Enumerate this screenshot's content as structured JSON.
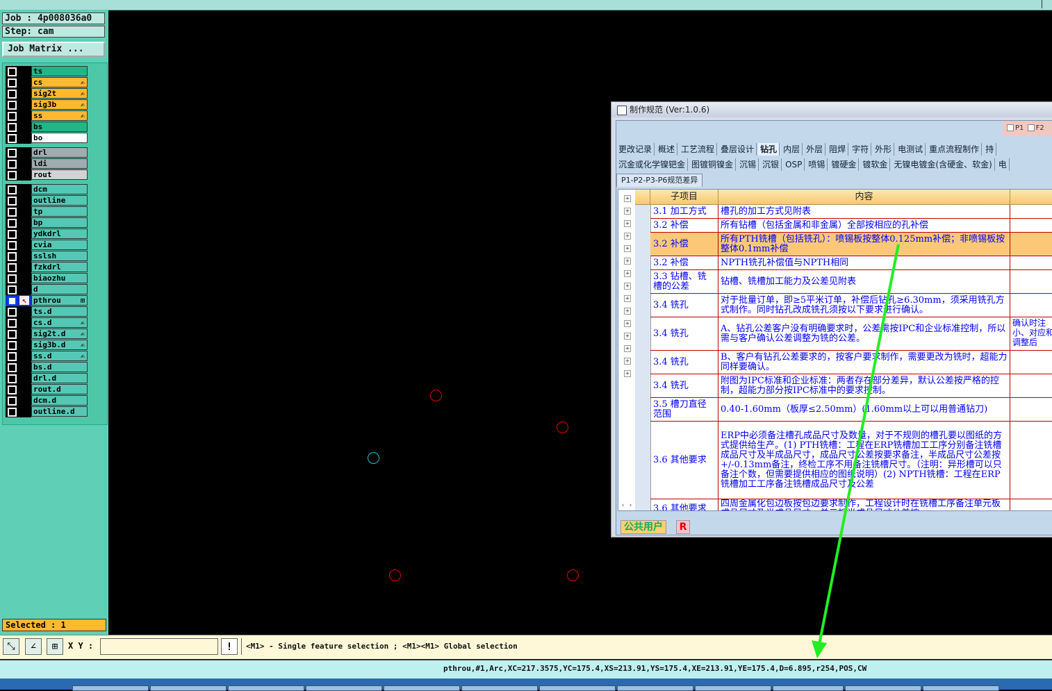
{
  "job": {
    "job_label": "Job : 4p008036a0",
    "step_label": "Step: cam",
    "matrix_button": "Job Matrix ..."
  },
  "layers": [
    {
      "name": "ts",
      "color": "green",
      "mark": ""
    },
    {
      "name": "cs",
      "color": "orange",
      "mark": "✍"
    },
    {
      "name": "sig2t",
      "color": "orange",
      "mark": "✍"
    },
    {
      "name": "sig3b",
      "color": "orange",
      "mark": "✍"
    },
    {
      "name": "ss",
      "color": "orange",
      "mark": "✍"
    },
    {
      "name": "bs",
      "color": "green",
      "mark": ""
    },
    {
      "name": "bo",
      "color": "white",
      "mark": ""
    },
    {
      "name": "drl",
      "color": "gray",
      "mark": ""
    },
    {
      "name": "ldi",
      "color": "gray",
      "mark": ""
    },
    {
      "name": "rout",
      "color": "lgray",
      "mark": ""
    },
    {
      "name": "dcm",
      "color": "teal",
      "mark": ""
    },
    {
      "name": "outline",
      "color": "teal",
      "mark": ""
    },
    {
      "name": "tp",
      "color": "teal",
      "mark": ""
    },
    {
      "name": "bp",
      "color": "teal",
      "mark": ""
    },
    {
      "name": "ydkdrl",
      "color": "teal",
      "mark": ""
    },
    {
      "name": "cvia",
      "color": "teal",
      "mark": ""
    },
    {
      "name": "sslsh",
      "color": "teal",
      "mark": ""
    },
    {
      "name": "fzkdrl",
      "color": "teal",
      "mark": ""
    },
    {
      "name": "biaozhu",
      "color": "teal",
      "mark": ""
    },
    {
      "name": "d",
      "color": "teal",
      "mark": ""
    },
    {
      "name": "pthrou",
      "color": "teal",
      "mark": "⊞",
      "active": true
    },
    {
      "name": "ts.d",
      "color": "teal",
      "mark": ""
    },
    {
      "name": "cs.d",
      "color": "teal",
      "mark": "✍"
    },
    {
      "name": "sig2t.d",
      "color": "teal",
      "mark": "✍"
    },
    {
      "name": "sig3b.d",
      "color": "teal",
      "mark": "✍"
    },
    {
      "name": "ss.d",
      "color": "teal",
      "mark": "✍"
    },
    {
      "name": "bs.d",
      "color": "teal",
      "mark": ""
    },
    {
      "name": "drl.d",
      "color": "teal",
      "mark": ""
    },
    {
      "name": "rout.d",
      "color": "teal",
      "mark": ""
    },
    {
      "name": "dcm.d",
      "color": "teal",
      "mark": ""
    },
    {
      "name": "outline.d",
      "color": "teal",
      "mark": ""
    }
  ],
  "selected_label": "Selected : 1",
  "dialog": {
    "title": "制作规范 (Ver:1.0.6)",
    "p1": "P1",
    "p2": "F2",
    "tabs_row1": [
      "更改记录",
      "概述",
      "工艺流程",
      "叠层设计",
      "钻孔",
      "内层",
      "外层",
      "阻焊",
      "字符",
      "外形",
      "电测试",
      "重点流程制作",
      "持"
    ],
    "active_tab": "钻孔",
    "tabs_row2": [
      "沉金或化学镍钯金",
      "图镀铜镍金",
      "沉锡",
      "沉银",
      "OSP",
      "喷锡",
      "镀硬金",
      "镀软金",
      "无镍电镀金(含硬金、软金)",
      "电"
    ],
    "tab_row3": "P1-P2-P3-P6规范差异",
    "col_sub": "子项目",
    "col_content": "内容",
    "rows": [
      {
        "sub": "3.1 加工方式",
        "content": "槽孔的加工方式见附表",
        "extra": ""
      },
      {
        "sub": "3.2 补偿",
        "content": "所有钻槽（包括金属和非金属）全部按相应的孔补偿",
        "extra": ""
      },
      {
        "sub": "3.2 补偿",
        "content": "所有PTH铣槽（包括铣孔）：喷锡板按整体0.125mm补偿；非喷锡板按整体0.1mm补偿",
        "extra": ""
      },
      {
        "sub": "3.2 补偿",
        "content": "NPTH铣孔补偿值与NPTH相同",
        "extra": ""
      },
      {
        "sub": "3.3 钻槽、铣槽的公差",
        "content": "钻槽、铣槽加工能力及公差见附表",
        "extra": ""
      },
      {
        "sub": "3.4 铣孔",
        "content": "对于批量订单，即≥5平米订单，补偿后钻孔≥6.30mm，须采用铣孔方式制作。同时钻孔改成铣孔须按以下要求进行确认。",
        "extra": ""
      },
      {
        "sub": "3.4 铣孔",
        "content": "A、钻孔公差客户没有明确要求时，公差需按IPC和企业标准控制，所以需与客户确认公差调整为铣的公差。",
        "extra": "确认时注小、对应和调整后"
      },
      {
        "sub": "3.4 铣孔",
        "content": "B、客户有钻孔公差要求的，按客户要求制作，需要更改为铣时，超能力同样要确认。",
        "extra": ""
      },
      {
        "sub": "3.4 铣孔",
        "content": "附图为IPC标准和企业标准：两者存在部分差异，默认公差按严格的控制，超能力部分按IPC标准中的要求控制。",
        "extra": ""
      },
      {
        "sub": "3.5 槽刀直径范围",
        "content": "0.40-1.60mm（板厚≤2.50mm）(1.60mm以上可以用普通钻刀)",
        "extra": ""
      },
      {
        "sub": "3.6 其他要求",
        "content": "ERP中必须备注槽孔成品尺寸及数量，对于不规则的槽孔要以图纸的方式提供给生产。(1) PTH铣槽：工程在ERP铣槽加工工序分别备注铣槽成品尺寸及半成品尺寸，成品尺寸公差按要求备注，半成品尺寸公差按+/-0.13mm备注，终检工序不用备注铣槽尺寸。（注明：异形槽可以只备注个数，但需要提供相应的图纸说明）(2) NPTH铣槽：工程在ERP铣槽加工工序备注铣槽成品尺寸及公差",
        "extra": ""
      },
      {
        "sub": "3.6 其他要求",
        "content": "四周金属化包边板按包边要求制作，工程设计时在铣槽工序备注单元板成品尺寸及半成品尺寸，单元板半成品尺寸公差按",
        "extra": ""
      }
    ],
    "user_label": "公共用户",
    "r_label": "R"
  },
  "toolbar": {
    "xy_label": "X Y :",
    "xy_value": "",
    "info_label": "!",
    "message": "<M1> - Single feature selection ; <M1><M1> Global selection"
  },
  "status": "pthrou,#1,Arc,XC=217.3575,YC=175.4,XS=213.91,YS=175.4,XE=213.91,YE=175.4,D=6.895,r254,POS,CW",
  "colors": {
    "arrow": "#22ee22",
    "pad_red": "#e00000",
    "pad_cyan": "#20c0d0"
  }
}
